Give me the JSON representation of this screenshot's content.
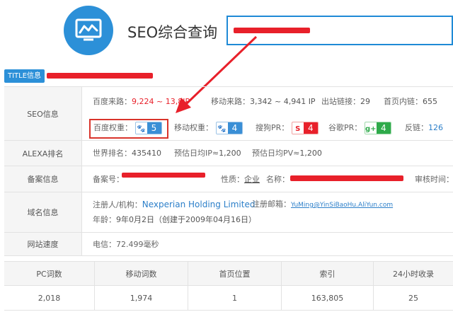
{
  "header": {
    "site_title": "SEO综合查询",
    "logo_icon": "line-chart-monitor-icon"
  },
  "title_info": {
    "badge": "TITLE信息"
  },
  "seo": {
    "label": "SEO信息",
    "baidu_traffic_label": "百度来路：",
    "baidu_traffic_value": "9,224 ~ 13,8",
    "baidu_traffic_suffix": "IP",
    "mobile_traffic_label": "移动来路：",
    "mobile_traffic_value": "3,342 ~ 4,941 IP",
    "outlinks_label": "出站链接：",
    "outlinks_value": "29",
    "home_inlinks_label": "首页内链：",
    "home_inlinks_value": "655",
    "baidu_weight_label": "百度权重：",
    "baidu_weight_value": "5",
    "mobile_weight_label": "移动权重：",
    "mobile_weight_value": "4",
    "sogou_pr_label": "搜狗PR：",
    "sogou_pr_value": "4",
    "google_pr_label": "谷歌PR：",
    "google_pr_value": "4",
    "backlinks_label": "反链：",
    "backlinks_value": "126"
  },
  "alexa": {
    "label": "ALEXA排名",
    "world_rank_label": "世界排名：",
    "world_rank_value": "435410",
    "daily_ip_label": "预估日均IP≈",
    "daily_ip_value": "1,200",
    "daily_pv_label": "预估日均PV≈",
    "daily_pv_value": "1,200"
  },
  "icp": {
    "label": "备案信息",
    "record_no_label": "备案号：",
    "nature_label": "性质：",
    "nature_value": "企业",
    "name_label": "名称：",
    "review_time_label": "审核时间："
  },
  "domain": {
    "label": "域名信息",
    "registrant_label": "注册人/机构：",
    "registrant_value": "Nexperian Holding Limited",
    "email_label": "注册邮箱：",
    "email_value": "YuMing@YinSiBaoHu.AliYun.com",
    "age_label": "年龄：",
    "age_value": "9年0月2日",
    "created_value": "（创建于2009年04月16日）"
  },
  "speed": {
    "label": "网站速度",
    "value": "电信：72.499毫秒"
  },
  "stats": {
    "headers": [
      "PC词数",
      "移动词数",
      "首页位置",
      "索引",
      "24小时收录"
    ],
    "values": [
      "2,018",
      "1,974",
      "1",
      "163,805",
      "25"
    ]
  },
  "colors": {
    "accent": "#2c90d8",
    "highlight": "#e8202a",
    "badge_green": "#2eaa4a"
  }
}
